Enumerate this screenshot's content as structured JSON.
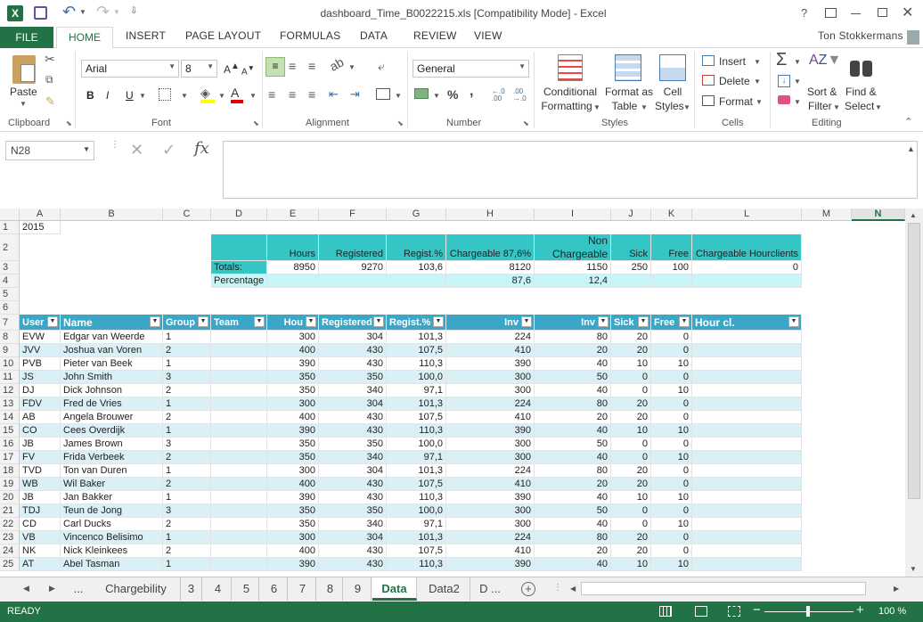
{
  "window": {
    "title": "dashboard_Time_B0022215.xls  [Compatibility Mode] - Excel",
    "user": "Ton  Stokkermans",
    "help": "?"
  },
  "tabs": {
    "file": "FILE",
    "home": "HOME",
    "insert": "INSERT",
    "page_layout": "PAGE LAYOUT",
    "formulas": "FORMULAS",
    "data": "DATA",
    "review": "REVIEW",
    "view": "VIEW"
  },
  "ribbon": {
    "clipboard": {
      "label": "Clipboard",
      "paste": "Paste"
    },
    "font": {
      "label": "Font",
      "name": "Arial",
      "size": "8",
      "bold": "B",
      "italic": "I",
      "underline": "U"
    },
    "alignment": {
      "label": "Alignment"
    },
    "number": {
      "label": "Number",
      "format": "General",
      "percent": "%",
      "comma": ","
    },
    "styles": {
      "label": "Styles",
      "cond1": "Conditional",
      "cond2": "Formatting",
      "fmt1": "Format as",
      "fmt2": "Table",
      "cell1": "Cell",
      "cell2": "Styles"
    },
    "cells": {
      "label": "Cells",
      "insert": "Insert",
      "delete": "Delete",
      "format": "Format"
    },
    "editing": {
      "label": "Editing",
      "sort1": "Sort &",
      "sort2": "Filter",
      "find1": "Find &",
      "find2": "Select"
    }
  },
  "formula_bar": {
    "name_box": "N28",
    "fx": "fx",
    "formula": ""
  },
  "columns": [
    "A",
    "B",
    "C",
    "D",
    "E",
    "F",
    "G",
    "H",
    "I",
    "J",
    "K",
    "L",
    "M",
    "N"
  ],
  "sheet": {
    "r1": {
      "year": "2015"
    },
    "r2": {
      "hours": "Hours",
      "registered": "Registered",
      "regist_pct": "Regist.%",
      "chargeable": "Chargeable 87,6%",
      "nonchg1": "Non",
      "nonchg2": "Chargeable",
      "sick": "Sick",
      "free": "Free",
      "chg_hour": "Chargeable Hourclients"
    },
    "r3": {
      "label": "Totals:",
      "hours": "8950",
      "registered": "9270",
      "regist_pct": "103,6",
      "chargeable": "8120",
      "nonchg": "1150",
      "sick": "250",
      "free": "100",
      "chg_hour": "0"
    },
    "r4": {
      "label": "Percentage",
      "chargeable": "87,6",
      "nonchg": "12,4"
    },
    "headers": [
      "User",
      "Name",
      "Group",
      "Team",
      "Hou",
      "Registered",
      "Regist.%",
      "Inv",
      "Inv",
      "Sick",
      "Free",
      "Hour cl."
    ],
    "rows": [
      [
        "EVW",
        "Edgar van Weerde",
        "1",
        "",
        "300",
        "304",
        "101,3",
        "224",
        "80",
        "20",
        "0"
      ],
      [
        "JVV",
        "Joshua van Voren",
        "2",
        "",
        "400",
        "430",
        "107,5",
        "410",
        "20",
        "20",
        "0"
      ],
      [
        "PVB",
        "Pieter van Beek",
        "1",
        "",
        "390",
        "430",
        "110,3",
        "390",
        "40",
        "10",
        "10"
      ],
      [
        "JS",
        "John Smith",
        "3",
        "",
        "350",
        "350",
        "100,0",
        "300",
        "50",
        "0",
        "0"
      ],
      [
        "DJ",
        "Dick Johnson",
        "2",
        "",
        "350",
        "340",
        "97,1",
        "300",
        "40",
        "0",
        "10"
      ],
      [
        "FDV",
        "Fred de Vries",
        "1",
        "",
        "300",
        "304",
        "101,3",
        "224",
        "80",
        "20",
        "0"
      ],
      [
        "AB",
        "Angela Brouwer",
        "2",
        "",
        "400",
        "430",
        "107,5",
        "410",
        "20",
        "20",
        "0"
      ],
      [
        "CO",
        "Cees Overdijk",
        "1",
        "",
        "390",
        "430",
        "110,3",
        "390",
        "40",
        "10",
        "10"
      ],
      [
        "JB",
        "James Brown",
        "3",
        "",
        "350",
        "350",
        "100,0",
        "300",
        "50",
        "0",
        "0"
      ],
      [
        "FV",
        "Frida Verbeek",
        "2",
        "",
        "350",
        "340",
        "97,1",
        "300",
        "40",
        "0",
        "10"
      ],
      [
        "TVD",
        "Ton van Duren",
        "1",
        "",
        "300",
        "304",
        "101,3",
        "224",
        "80",
        "20",
        "0"
      ],
      [
        "WB",
        "Wil Baker",
        "2",
        "",
        "400",
        "430",
        "107,5",
        "410",
        "20",
        "20",
        "0"
      ],
      [
        "JB",
        "Jan Bakker",
        "1",
        "",
        "390",
        "430",
        "110,3",
        "390",
        "40",
        "10",
        "10"
      ],
      [
        "TDJ",
        "Teun de Jong",
        "3",
        "",
        "350",
        "350",
        "100,0",
        "300",
        "50",
        "0",
        "0"
      ],
      [
        "CD",
        "Carl Ducks",
        "2",
        "",
        "350",
        "340",
        "97,1",
        "300",
        "40",
        "0",
        "10"
      ],
      [
        "VB",
        "Vincenco Belisimo",
        "1",
        "",
        "300",
        "304",
        "101,3",
        "224",
        "80",
        "20",
        "0"
      ],
      [
        "NK",
        "Nick Kleinkees",
        "2",
        "",
        "400",
        "430",
        "107,5",
        "410",
        "20",
        "20",
        "0"
      ],
      [
        "AT",
        "Abel Tasman",
        "1",
        "",
        "390",
        "430",
        "110,3",
        "390",
        "40",
        "10",
        "10"
      ]
    ]
  },
  "sheet_tabs": [
    "...",
    "Chargebility",
    "3",
    "4",
    "5",
    "6",
    "7",
    "8",
    "9",
    "Data",
    "Data2",
    "D ..."
  ],
  "active_sheet": "Data",
  "status": {
    "ready": "READY",
    "zoom": "100 %"
  },
  "colors": {
    "excel_green": "#217346",
    "teal": "#36c5c5",
    "light_teal": "#c9f4f8",
    "header_blue": "#3aa6c8",
    "band": "#dbeff7"
  }
}
